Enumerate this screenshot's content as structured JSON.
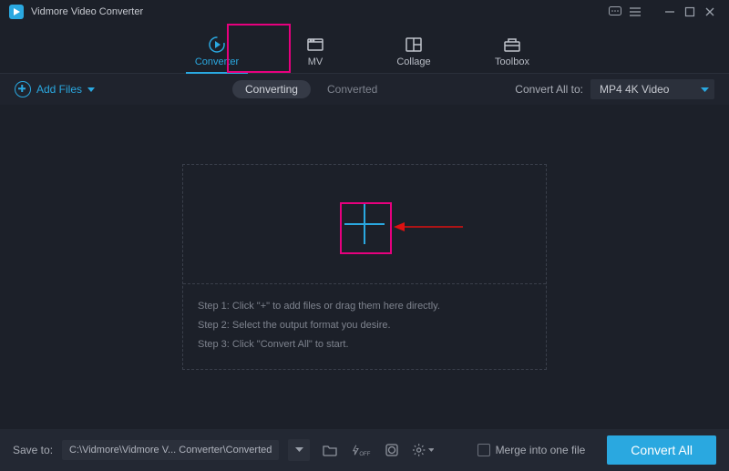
{
  "titlebar": {
    "app_name": "Vidmore Video Converter"
  },
  "main_tabs": {
    "converter": "Converter",
    "mv": "MV",
    "collage": "Collage",
    "toolbox": "Toolbox"
  },
  "subbar": {
    "add_files": "Add Files",
    "converting": "Converting",
    "converted": "Converted",
    "convert_all_to": "Convert All to:",
    "format_selected": "MP4 4K Video"
  },
  "dropzone": {
    "step1": "Step 1: Click \"+\" to add files or drag them here directly.",
    "step2": "Step 2: Select the output format you desire.",
    "step3": "Step 3: Click \"Convert All\" to start."
  },
  "footer": {
    "save_to_label": "Save to:",
    "save_path": "C:\\Vidmore\\Vidmore V... Converter\\Converted",
    "merge_label": "Merge into one file",
    "convert_all": "Convert All"
  },
  "colors": {
    "accent": "#2aa8e0",
    "annotation": "#e6007e"
  }
}
